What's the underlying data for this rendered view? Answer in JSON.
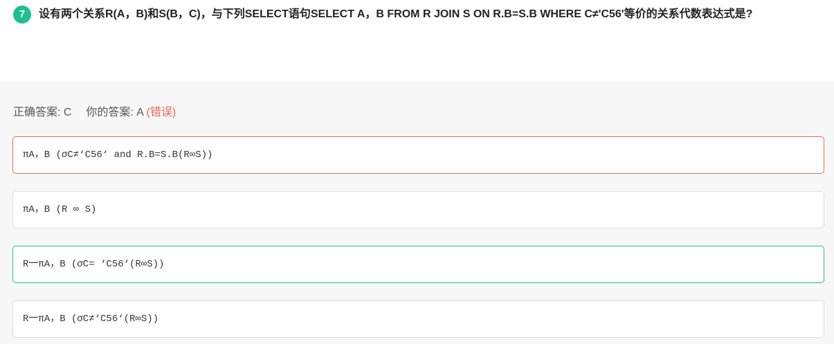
{
  "question": {
    "number": "7",
    "text": "设有两个关系R(A，B)和S(B，C)，与下列SELECT语句SELECT  A，B FROM  R JOIN S ON R.B=S.B WHERE  C≠'C56'等价的关系代数表达式是?"
  },
  "result": {
    "correct_label": "正确答案:",
    "correct_value": "C",
    "yours_label": "你的答案:",
    "yours_value": "A",
    "status": "(错误)"
  },
  "options": [
    {
      "text": "πA，B (σC≠‘C56‘ and R.B=S.B(R∞S))",
      "state": "selected-wrong"
    },
    {
      "text": "πA，B (R ∞ S)",
      "state": "normal"
    },
    {
      "text": "R一πA，B (σC= ‘C56‘(R∞S))",
      "state": "correct"
    },
    {
      "text": "R一πA，B (σC≠‘C56‘(R∞S))",
      "state": "normal"
    }
  ],
  "colors": {
    "accent_green": "#1ebf94",
    "error_red": "#e86a4f"
  }
}
